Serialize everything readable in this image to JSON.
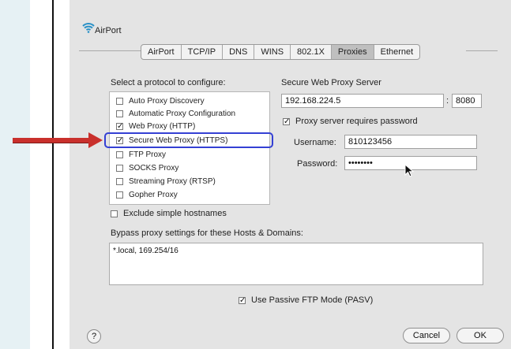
{
  "window": {
    "title": "AirPort",
    "tabs": [
      "AirPort",
      "TCP/IP",
      "DNS",
      "WINS",
      "802.1X",
      "Proxies",
      "Ethernet"
    ],
    "active_tab": "Proxies"
  },
  "protocols": {
    "label": "Select a protocol to configure:",
    "items": [
      {
        "label": "Auto Proxy Discovery",
        "checked": false
      },
      {
        "label": "Automatic Proxy Configuration",
        "checked": false
      },
      {
        "label": "Web Proxy (HTTP)",
        "checked": true
      },
      {
        "label": "Secure Web Proxy (HTTPS)",
        "checked": true
      },
      {
        "label": "FTP Proxy",
        "checked": false
      },
      {
        "label": "SOCKS Proxy",
        "checked": false
      },
      {
        "label": "Streaming Proxy (RTSP)",
        "checked": false
      },
      {
        "label": "Gopher Proxy",
        "checked": false
      }
    ]
  },
  "server": {
    "label": "Secure Web Proxy Server",
    "host": "192.168.224.5",
    "port": "8080",
    "requires_password_label": "Proxy server requires password",
    "requires_password_checked": true,
    "username_label": "Username:",
    "username": "810123456",
    "password_label": "Password:",
    "password": "••••••••"
  },
  "exclude": {
    "label": "Exclude simple hostnames",
    "checked": false
  },
  "bypass": {
    "label": "Bypass proxy settings for these Hosts & Domains:",
    "value": "*.local, 169.254/16"
  },
  "ftp_passive": {
    "label": "Use Passive FTP Mode (PASV)",
    "checked": true
  },
  "buttons": {
    "help": "?",
    "cancel": "Cancel",
    "ok": "OK"
  },
  "colors": {
    "highlight": "#3440d4",
    "arrow": "#c9302c"
  }
}
